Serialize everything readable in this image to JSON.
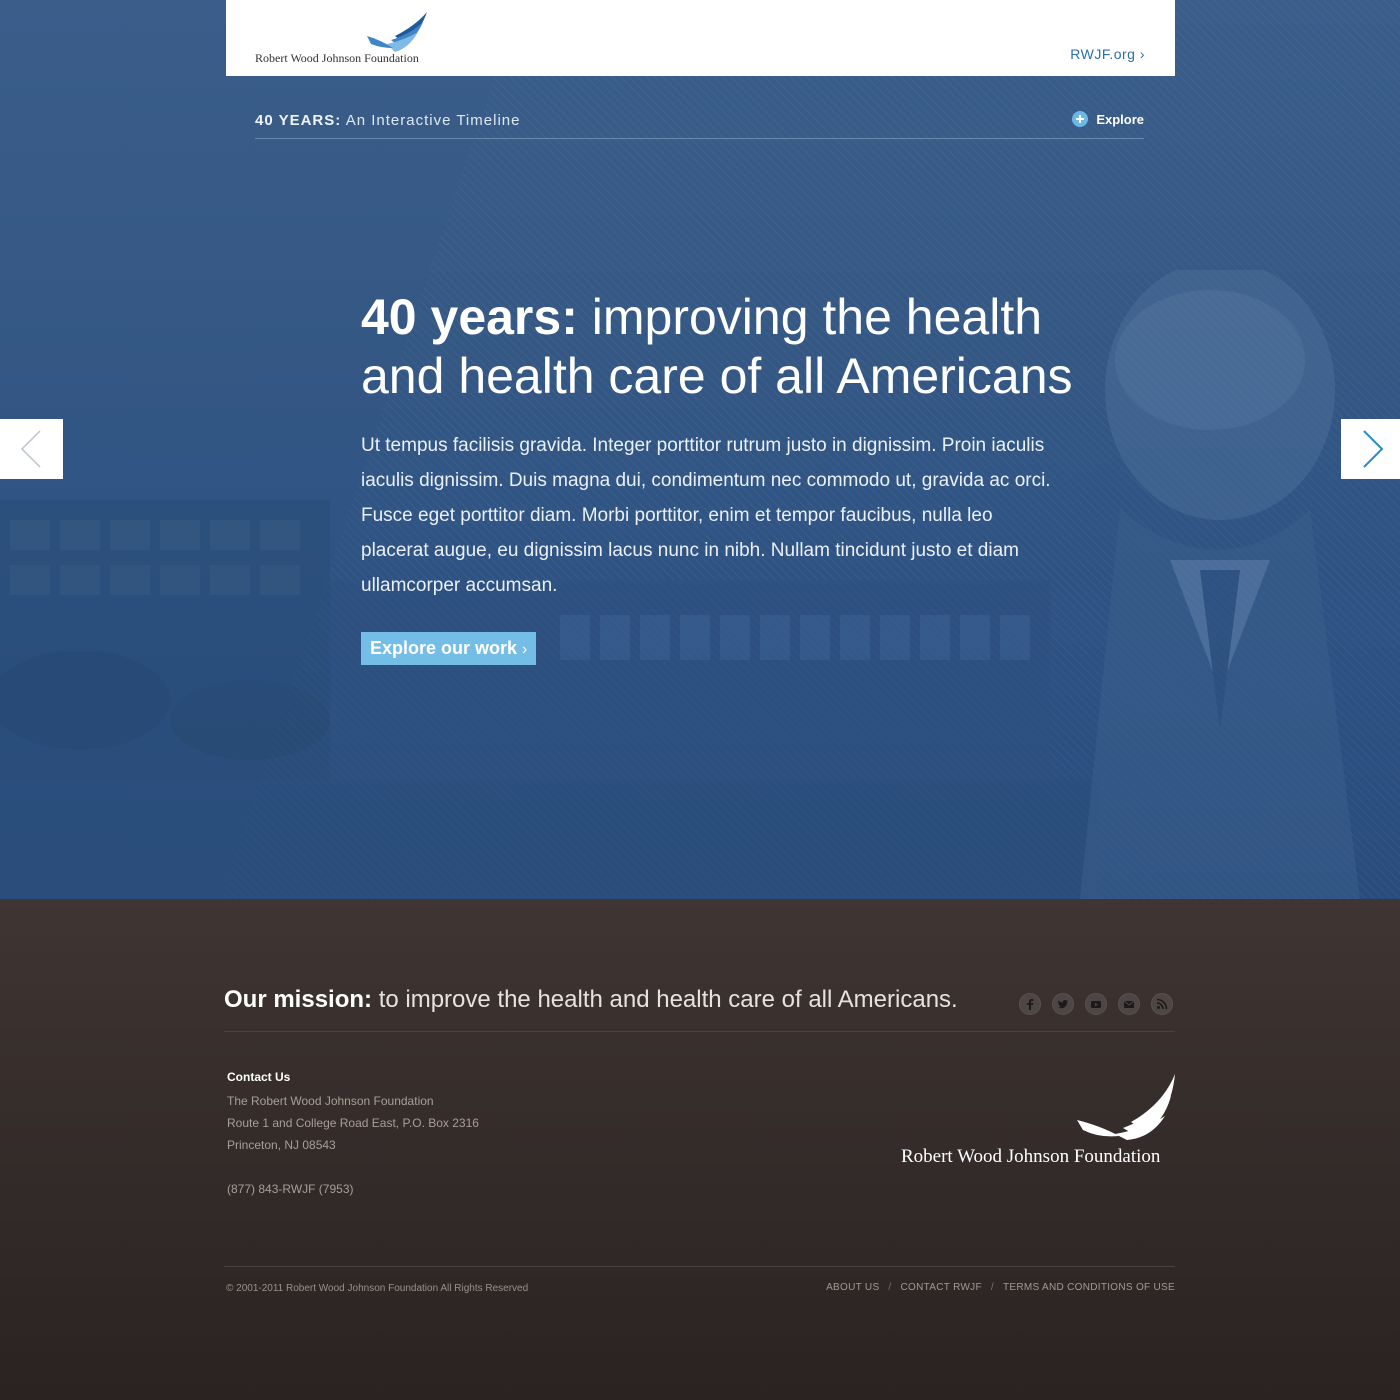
{
  "header": {
    "org_name": "Robert Wood Johnson Foundation",
    "site_link": "RWJF.org ›"
  },
  "timeline": {
    "title_strong": "40 YEARS:",
    "title_light": "An Interactive Timeline",
    "explore_label": "Explore"
  },
  "hero": {
    "headline_strong": "40 years:",
    "headline_light": "improving the health and health care of all Americans",
    "body": "Ut tempus facilisis gravida. Integer porttitor rutrum justo in dignissim. Proin iaculis iaculis dignissim. Duis magna dui, condimentum nec commodo ut, gravida ac orci. Fusce eget porttitor diam. Morbi porttitor, enim et tempor faucibus, nulla leo placerat augue, eu dignissim lacus nunc in nibh. Nullam tincidunt justo et diam ullamcorper accumsan.",
    "cta_label": "Explore our work",
    "cta_chevron": "›"
  },
  "footer": {
    "mission_strong": "Our mission:",
    "mission_text": "to improve the health and health care of all Americans.",
    "social": [
      "facebook-icon",
      "twitter-icon",
      "youtube-icon",
      "email-icon",
      "rss-icon"
    ],
    "contact": {
      "title": "Contact Us",
      "line1": "The Robert Wood Johnson Foundation",
      "line2": "Route 1 and College Road East, P.O. Box 2316",
      "line3": "Princeton, NJ 08543",
      "phone": "(877) 843-RWJF (7953)"
    },
    "logo_text": "Robert Wood Johnson Foundation",
    "copyright": "© 2001-2011 Robert Wood Johnson Foundation   All Rights Reserved",
    "links": {
      "about": "ABOUT US",
      "contact": "CONTACT RWJF",
      "terms": "TERMS AND CONDITIONS OF USE",
      "separator": "/"
    }
  },
  "colors": {
    "hero_blue": "#355884",
    "accent_light_blue": "#73bde6",
    "link_blue": "#2a6fa8",
    "footer_brown": "#3a302e"
  }
}
